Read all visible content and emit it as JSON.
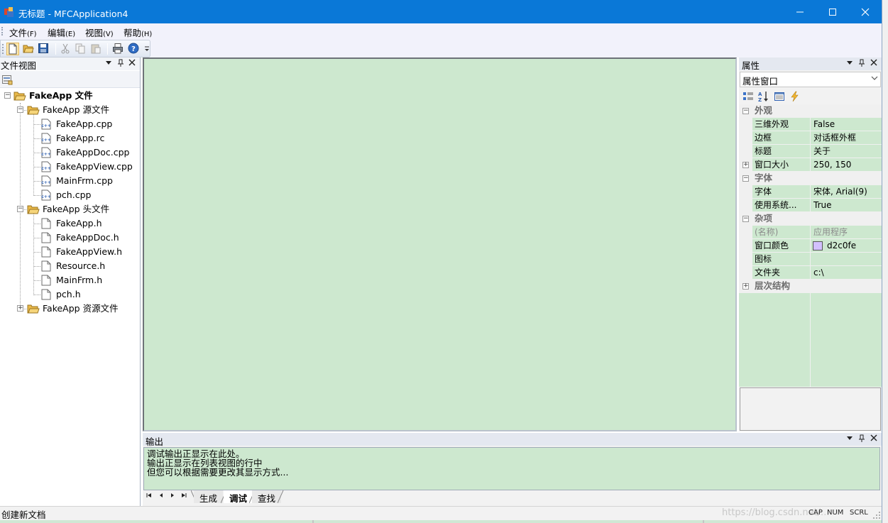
{
  "window": {
    "title": "无标题 - MFCApplication4",
    "minimize_glyph": "—",
    "maximize_glyph": "☐",
    "close_glyph": "✕"
  },
  "menu": {
    "items": [
      {
        "label": "文件",
        "accel": "(F)"
      },
      {
        "label": "编辑",
        "accel": "(E)"
      },
      {
        "label": "视图",
        "accel": "(V)"
      },
      {
        "label": "帮助",
        "accel": "(H)"
      }
    ]
  },
  "toolbar": {
    "buttons": [
      "new-document-icon",
      "open-folder-icon",
      "save-icon",
      "cut-icon",
      "copy-icon",
      "paste-icon",
      "print-icon",
      "help-icon"
    ]
  },
  "file_view": {
    "title": "文件视图",
    "pane_controls": {
      "dropdown": "▼",
      "pin": "🖈",
      "close": "✕"
    },
    "tree": {
      "root": "FakeApp 文件",
      "source_folder": "FakeApp 源文件",
      "source_files": [
        "FakeApp.cpp",
        "FakeApp.rc",
        "FakeAppDoc.cpp",
        "FakeAppView.cpp",
        "MainFrm.cpp",
        "pch.cpp"
      ],
      "header_folder": "FakeApp 头文件",
      "header_files": [
        "FakeApp.h",
        "FakeAppDoc.h",
        "FakeAppView.h",
        "Resource.h",
        "MainFrm.h",
        "pch.h"
      ],
      "resource_folder": "FakeApp 资源文件"
    }
  },
  "properties": {
    "title": "属性",
    "combo_value": "属性窗口",
    "categories": [
      {
        "name": "外观",
        "expanded": true,
        "props": [
          {
            "name": "三维外观",
            "value": "False"
          },
          {
            "name": "边框",
            "value": "对话框外框"
          },
          {
            "name": "标题",
            "value": "关于"
          },
          {
            "name": "窗口大小",
            "value": "250, 150",
            "expandable": true
          }
        ]
      },
      {
        "name": "字体",
        "expanded": true,
        "props": [
          {
            "name": "字体",
            "value": "宋体, Arial(9)"
          },
          {
            "name": "使用系统...",
            "value": "True"
          }
        ]
      },
      {
        "name": "杂项",
        "expanded": true,
        "props": [
          {
            "name": "(名称)",
            "value": "应用程序",
            "disabled": true
          },
          {
            "name": "窗口颜色",
            "value": "d2c0fe",
            "swatch": "#d2c0fe"
          },
          {
            "name": "图标",
            "value": ""
          },
          {
            "name": "文件夹",
            "value": "c:\\"
          }
        ]
      },
      {
        "name": "层次结构",
        "expanded": false,
        "props": []
      }
    ]
  },
  "output": {
    "title": "输出",
    "lines": [
      "调试输出正显示在此处。",
      "输出正显示在列表视图的行中",
      "但您可以根据需要更改其显示方式..."
    ],
    "tabs": [
      {
        "label": "生成",
        "active": false
      },
      {
        "label": "调试",
        "active": true
      },
      {
        "label": "查找",
        "active": false
      }
    ],
    "nav": [
      "⏮",
      "◀",
      "▶",
      "⏭"
    ]
  },
  "status": {
    "text": "创建新文档",
    "indicators": [
      "CAP",
      "NUM",
      "SCRL"
    ],
    "watermark": "https://blog.csdn.net/..."
  },
  "colors": {
    "titlebar": "#0a78d7",
    "content_bg": "#cde8cf",
    "swatch": "#d2c0fe"
  }
}
